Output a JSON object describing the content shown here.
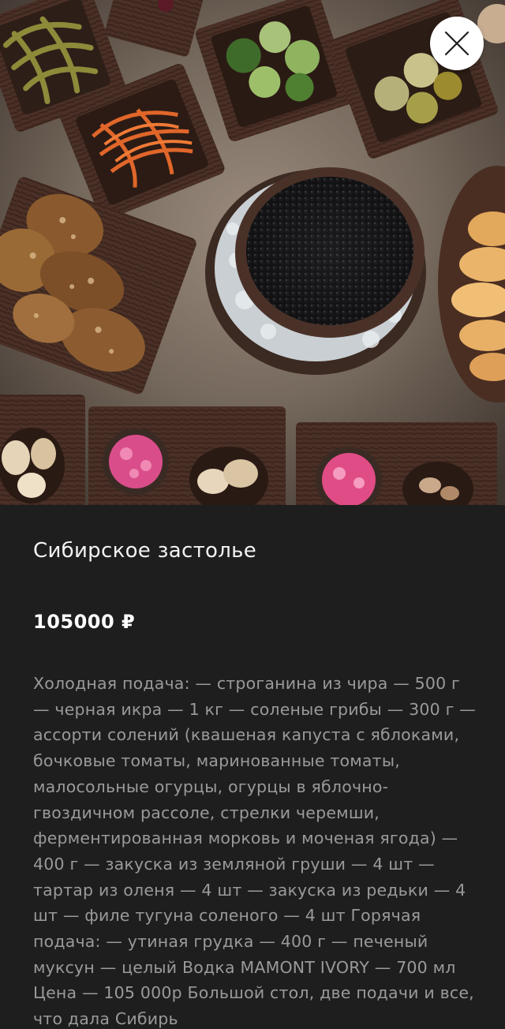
{
  "product": {
    "title": "Сибирское застолье",
    "price": "105000 ₽",
    "description": "Холодная подача: — строганина из чира — 500 г — черная икра — 1 кг — соленые грибы — 300 г — ассорти солений (квашеная капуста с яблоками, бочковые томаты, маринованные томаты, малосольные огурцы, огурцы в яблочно-гвоздичном рассоле, стрелки черемши, ферментированная морковь и моченая ягода) — 400 г — закуска из земляной груши — 4 шт — тартар из оленя — 4 шт — закуска из редьки — 4 шт — филе тугуна соленого — 4 шт Горячая подача: — утиная грудка — 400 г — печеный муксун — целый Водка MAMONT IVORY — 700 мл Цена — 105 000р Большой стол, две подачи и все, что дала Сибирь"
  },
  "icons": {
    "close": "close-icon"
  },
  "colors": {
    "background": "#1e1e1e",
    "title": "#f2f2f2",
    "price": "#ffffff",
    "description": "#9a9a9a"
  }
}
